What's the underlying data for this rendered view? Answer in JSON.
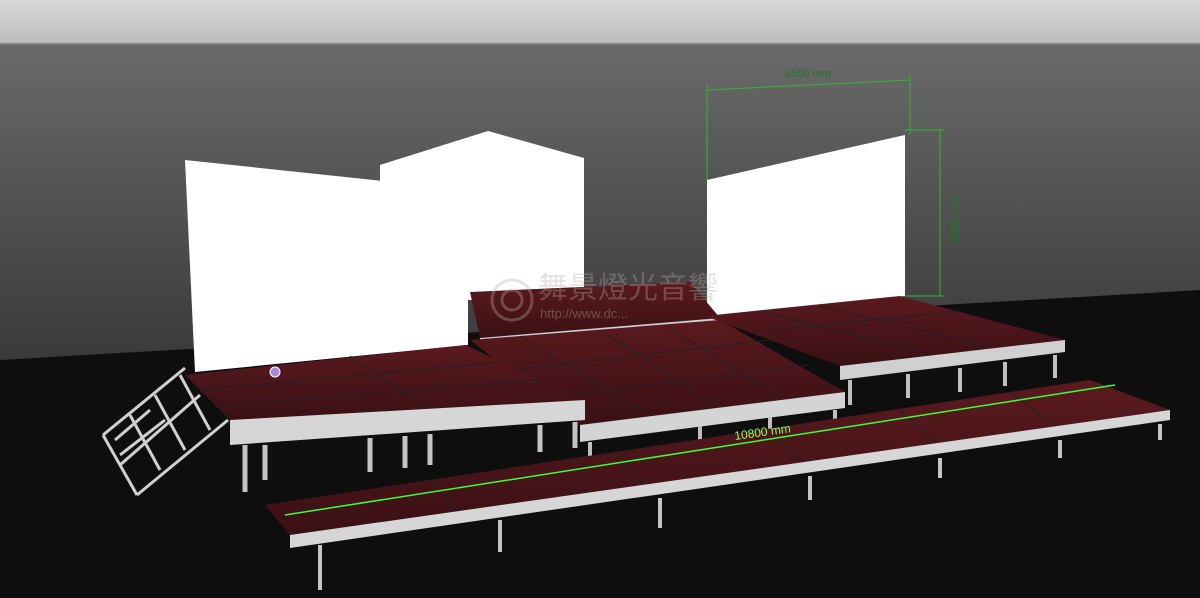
{
  "scene": {
    "dimensions": {
      "width_label": "3500 mm",
      "height_label": "3500 mm",
      "length_label": "10800 mm"
    },
    "watermark": {
      "brand_text": "舞景燈光音響",
      "url_text": "http://www.dc..."
    },
    "colors": {
      "sky_top": "#d4d4d4",
      "sky_bottom": "#2e2e2e",
      "ground": "#0d0d0d",
      "stage_deck": "#4a1418",
      "stage_edge": "#cfcfcf",
      "screen": "#ffffff",
      "dimension_line": "#2fb82f"
    }
  }
}
